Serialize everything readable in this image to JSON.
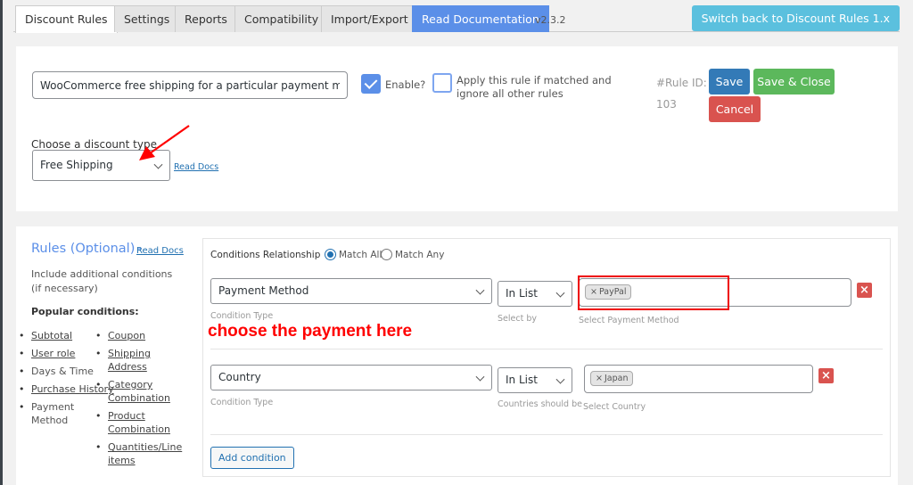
{
  "tabs": [
    {
      "label": "Discount Rules",
      "active": true
    },
    {
      "label": "Settings"
    },
    {
      "label": "Reports"
    },
    {
      "label": "Compatibility"
    },
    {
      "label": "Import/Export"
    },
    {
      "label": "Read Documentation"
    }
  ],
  "version": "v2.3.2",
  "switch_button": "Switch back to Discount Rules 1.x",
  "rule": {
    "name_value": "WooCommerce free shipping for a particular payment method",
    "enable_label": "Enable?",
    "enable_checked": true,
    "apply_label": "Apply this rule if matched and ignore all other rules",
    "apply_checked": false,
    "rule_id_label": "#Rule ID:",
    "rule_id": "103",
    "save": "Save",
    "save_close": "Save & Close",
    "cancel": "Cancel"
  },
  "discount_type": {
    "label": "Choose a discount type",
    "selected": "Free Shipping",
    "read_docs": "Read Docs"
  },
  "rules": {
    "title": "Rules (Optional)",
    "dash": "-",
    "read_docs": "Read Docs",
    "description": "Include additional conditions (if necessary)",
    "popular_label": "Popular conditions:",
    "popular_left": [
      {
        "label": "Subtotal",
        "link": true
      },
      {
        "label": "User role",
        "link": true
      },
      {
        "label": "Days & Time",
        "link": false
      },
      {
        "label": "Purchase History",
        "link": true
      },
      {
        "label": "Payment Method",
        "link": false
      }
    ],
    "popular_right": [
      {
        "label": "Coupon",
        "link": true
      },
      {
        "label": "Shipping Address",
        "link": true
      },
      {
        "label": "Category Combination",
        "link": true
      },
      {
        "label": "Product Combination",
        "link": true
      },
      {
        "label": "Quantities/Line items",
        "link": true
      }
    ]
  },
  "conditions": {
    "relationship_label": "Conditions Relationship",
    "match_all": "Match All",
    "match_any": "Match Any",
    "selected_relationship": "Match All",
    "rows": [
      {
        "type": "Payment Method",
        "type_hint": "Condition Type",
        "operator": "In List",
        "operator_hint": "Select by",
        "tag": "PayPal",
        "value_hint": "Select Payment Method"
      },
      {
        "type": "Country",
        "type_hint": "Condition Type",
        "operator": "In List",
        "operator_hint": "Countries should be",
        "tag": "Japan",
        "value_hint": "Select Country"
      }
    ],
    "add_condition": "Add condition"
  },
  "annotation": {
    "text": "choose the payment here",
    "color": "#ff0000"
  },
  "icons": {
    "delete": "×",
    "tag_remove": "×"
  }
}
